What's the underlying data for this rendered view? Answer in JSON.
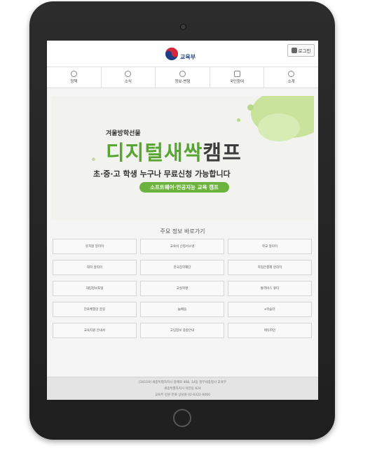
{
  "header": {
    "logo_text": "교육부",
    "login_label": "로그인"
  },
  "nav": [
    {
      "label": "정책",
      "icon": "info-icon"
    },
    {
      "label": "소식",
      "icon": "info-icon"
    },
    {
      "label": "정보·변형",
      "icon": "info-icon"
    },
    {
      "label": "국민참여",
      "icon": "chat-icon"
    },
    {
      "label": "소개",
      "icon": "info-icon"
    }
  ],
  "banner": {
    "subtitle": "겨울방학선물",
    "title_green1": "디지",
    "title_green2": "털새싹",
    "title_dark": "캠프",
    "line": "초·중·고 학생 누구나 무료신청 가능합니다",
    "pill": "소프트웨어·인공지능 교육 캠프"
  },
  "section_title": "주요 정보 바로가기",
  "links": [
    "유치원 알리미",
    "교육비 신청서소명",
    "학교 알리미",
    "대학 알리미",
    "한국장학재단",
    "학점은행제 알리미",
    "대입정보포털",
    "교실혁명",
    "통역비스 큐티",
    "진로체험망 꿈길",
    "늘배움",
    "e학습터",
    "교육지원 안내서",
    "고입정보 종합안내",
    "에듀파인"
  ],
  "footer": {
    "line1": "[30119] 세종특별자치시 갈매로 408, 14동 정부세종청사 교육부",
    "line2": "세종특별자치시 어진동 624",
    "line3": "교육부 민원 전화 상담원 02-6222-6060"
  },
  "colors": {
    "accent_green": "#57a632",
    "pill_green": "#6bb33c",
    "logo_blue": "#2a4a8a"
  }
}
